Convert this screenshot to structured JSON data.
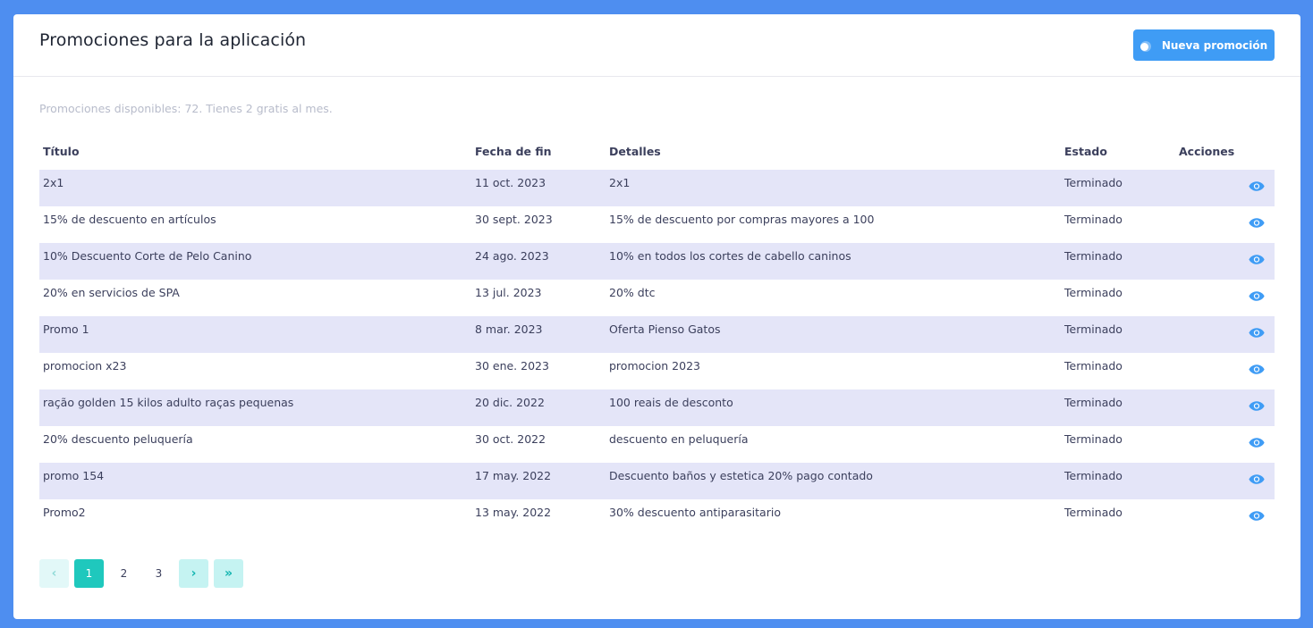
{
  "header": {
    "title": "Promociones para la aplicación",
    "new_button_label": "Nueva promoción",
    "new_button_icon": "toggle-icon"
  },
  "subtitle": "Promociones disponibles: 72. Tienes 2 gratis al mes.",
  "table": {
    "columns": [
      "Título",
      "Fecha de fin",
      "Detalles",
      "Estado",
      "Acciones"
    ],
    "rows": [
      {
        "title": "2x1",
        "end_date": "11 oct. 2023",
        "details": "2x1",
        "status": "Terminado",
        "action_icon": "eye-icon"
      },
      {
        "title": "15% de descuento en artículos",
        "end_date": "30 sept. 2023",
        "details": "15% de descuento por compras mayores a 100",
        "status": "Terminado",
        "action_icon": "eye-icon"
      },
      {
        "title": "10% Descuento Corte de Pelo Canino",
        "end_date": "24 ago. 2023",
        "details": "10% en todos los cortes de cabello caninos",
        "status": "Terminado",
        "action_icon": "eye-icon"
      },
      {
        "title": "20% en servicios de SPA",
        "end_date": "13 jul. 2023",
        "details": "20% dtc",
        "status": "Terminado",
        "action_icon": "eye-icon"
      },
      {
        "title": "Promo 1",
        "end_date": "8 mar. 2023",
        "details": "Oferta Pienso Gatos",
        "status": "Terminado",
        "action_icon": "eye-icon"
      },
      {
        "title": "promocion x23",
        "end_date": "30 ene. 2023",
        "details": "promocion 2023",
        "status": "Terminado",
        "action_icon": "eye-icon"
      },
      {
        "title": "ração golden 15 kilos adulto raças pequenas",
        "end_date": "20 dic. 2022",
        "details": "100 reais de desconto",
        "status": "Terminado",
        "action_icon": "eye-icon"
      },
      {
        "title": "20% descuento peluquería",
        "end_date": "30 oct. 2022",
        "details": "descuento en peluquería",
        "status": "Terminado",
        "action_icon": "eye-icon"
      },
      {
        "title": "promo 154",
        "end_date": "17 may. 2022",
        "details": "Descuento baños y estetica 20% pago contado",
        "status": "Terminado",
        "action_icon": "eye-icon"
      },
      {
        "title": "Promo2",
        "end_date": "13 may. 2022",
        "details": "30% descuento antiparasitario",
        "status": "Terminado",
        "action_icon": "eye-icon"
      }
    ]
  },
  "pagination": {
    "prev_icon": "chevron-left-icon",
    "pages": [
      "1",
      "2",
      "3"
    ],
    "current_page": "1",
    "next_icon": "chevron-right-icon",
    "last_icon": "double-chevron-right-icon"
  },
  "colors": {
    "background": "#4e8ef0",
    "primary_button": "#3f9cf5",
    "row_stripe": "#e4e5f8",
    "eye_icon": "#3f9cf5",
    "page_active": "#1fc8bd",
    "page_nav": "#c5f3f2"
  }
}
